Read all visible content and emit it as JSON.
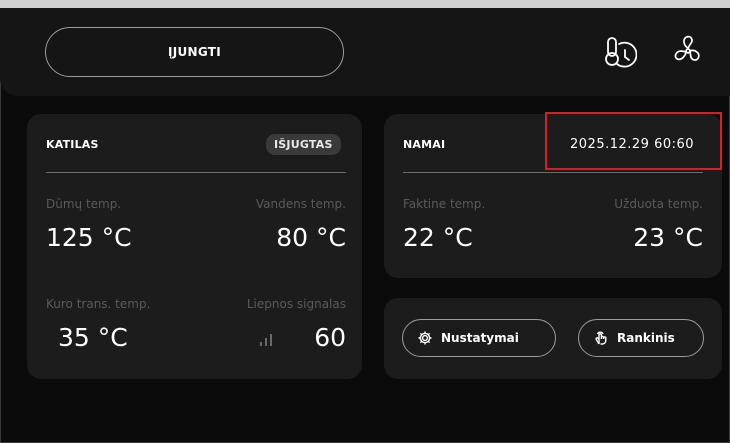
{
  "header": {
    "power_button_label": "ĮJUNGTI"
  },
  "icons": {
    "thermostat": "thermometer-clock-icon",
    "fan": "fan-icon",
    "settings": "gear-icon",
    "manual": "hand-pointer-icon",
    "signal": "signal-bars-icon"
  },
  "boiler": {
    "title": "KATILAS",
    "status": "IŠJUGTAS",
    "smoke_temp": {
      "label": "Dūmų temp.",
      "value": "125 °C"
    },
    "water_temp": {
      "label": "Vandens temp.",
      "value": "80 °C"
    },
    "fuel_temp": {
      "label": "Kuro trans. temp.",
      "value": "35 °C"
    },
    "flame": {
      "label": "Liepnos signalas",
      "value": "60"
    }
  },
  "home": {
    "title": "NAMAI",
    "datetime": "2025.12.29 60:60",
    "actual_temp": {
      "label": "Faktine temp.",
      "value": "22 °C"
    },
    "set_temp": {
      "label": "Užduota temp.",
      "value": "23 °C"
    }
  },
  "actions": {
    "settings_label": "Nustatymai",
    "manual_label": "Rankinis"
  },
  "colors": {
    "background": "#0b0b0b",
    "panel": "#1c1c1c",
    "highlight": "#d81f26"
  }
}
